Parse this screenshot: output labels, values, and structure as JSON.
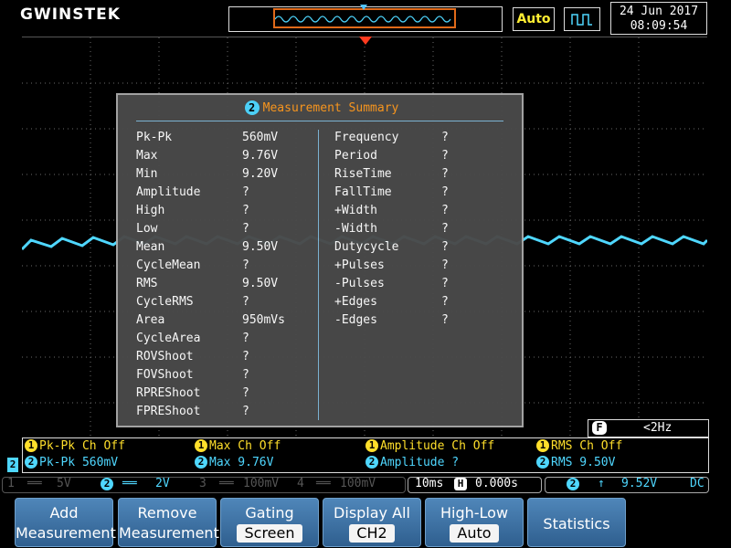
{
  "brand": "GWINSTEK",
  "header": {
    "auto_label": "Auto",
    "date": "24 Jun 2017",
    "time": "08:09:54"
  },
  "summary": {
    "channel": "2",
    "title": "Measurement Summary",
    "left": [
      {
        "label": "Pk-Pk",
        "value": "560mV"
      },
      {
        "label": "Max",
        "value": "9.76V"
      },
      {
        "label": "Min",
        "value": "9.20V"
      },
      {
        "label": "Amplitude",
        "value": "?"
      },
      {
        "label": "High",
        "value": "?"
      },
      {
        "label": "Low",
        "value": "?"
      },
      {
        "label": "Mean",
        "value": "9.50V"
      },
      {
        "label": "CycleMean",
        "value": "?"
      },
      {
        "label": "RMS",
        "value": "9.50V"
      },
      {
        "label": "CycleRMS",
        "value": "?"
      },
      {
        "label": "Area",
        "value": "950mVs"
      },
      {
        "label": "CycleArea",
        "value": "?"
      },
      {
        "label": "ROVShoot",
        "value": "?"
      },
      {
        "label": "FOVShoot",
        "value": "?"
      },
      {
        "label": "RPREShoot",
        "value": "?"
      },
      {
        "label": "FPREShoot",
        "value": "?"
      }
    ],
    "right": [
      {
        "label": "Frequency",
        "value": "?"
      },
      {
        "label": "Period",
        "value": "?"
      },
      {
        "label": "RiseTime",
        "value": "?"
      },
      {
        "label": "FallTime",
        "value": "?"
      },
      {
        "label": "+Width",
        "value": "?"
      },
      {
        "label": "-Width",
        "value": "?"
      },
      {
        "label": "Dutycycle",
        "value": "?"
      },
      {
        "label": "+Pulses",
        "value": "?"
      },
      {
        "label": "-Pulses",
        "value": "?"
      },
      {
        "label": "+Edges",
        "value": "?"
      },
      {
        "label": "-Edges",
        "value": "?"
      }
    ]
  },
  "freq_counter": {
    "icon": "F",
    "value": "<2Hz"
  },
  "readouts": {
    "row1": [
      {
        "num": "1",
        "text": "Pk-Pk Ch Off"
      },
      {
        "num": "1",
        "text": "Max Ch Off"
      },
      {
        "num": "1",
        "text": "Amplitude Ch Off"
      },
      {
        "num": "1",
        "text": "RMS Ch Off"
      }
    ],
    "row2_tag": "2",
    "row2": [
      {
        "num": "2",
        "text": "Pk-Pk 560mV"
      },
      {
        "num": "2",
        "text": "Max 9.76V"
      },
      {
        "num": "2",
        "text": "Amplitude ?"
      },
      {
        "num": "2",
        "text": "RMS 9.50V"
      }
    ]
  },
  "status": {
    "ch1": {
      "num": "1",
      "coupling": "══",
      "scale": "5V"
    },
    "ch2": {
      "num": "2",
      "coupling": "══",
      "scale": "2V"
    },
    "ch3": {
      "num": "3",
      "coupling": "══",
      "scale": "100mV"
    },
    "ch4": {
      "num": "4",
      "coupling": "══",
      "scale": "100mV"
    },
    "timebase": "10ms",
    "h_icon": "H",
    "h_position": "0.000s",
    "trig_source": "2",
    "trig_slope": "↑",
    "trig_level": "9.52V",
    "trig_coupling": "DC"
  },
  "softkeys": [
    {
      "line1": "Add",
      "line2": "Measurement"
    },
    {
      "line1": "Remove",
      "line2": "Measurement"
    },
    {
      "line1": "Gating",
      "value": "Screen"
    },
    {
      "line1": "Display All",
      "value": "CH2"
    },
    {
      "line1": "High-Low",
      "value": "Auto"
    },
    {
      "single": "Statistics"
    }
  ],
  "colors": {
    "ch1": "#ffdf2b",
    "ch2": "#4fd7ff",
    "title_orange": "#ff9a1f",
    "trigger_marker": "#ff3b1f",
    "softkey_blue": "#3a6d9e"
  }
}
